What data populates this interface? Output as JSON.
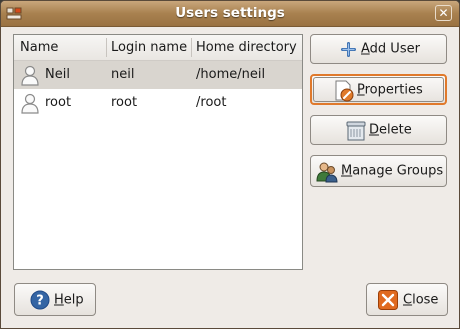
{
  "window": {
    "title": "Users settings",
    "close_glyph": "✕"
  },
  "table": {
    "columns": [
      "Name",
      "Login name",
      "Home directory"
    ],
    "rows": [
      {
        "name": "Neil",
        "login": "neil",
        "home": "/home/neil",
        "selected": true
      },
      {
        "name": "root",
        "login": "root",
        "home": "/root",
        "selected": false
      }
    ]
  },
  "buttons": {
    "add_user": {
      "mnemonic": "A",
      "rest": "dd User"
    },
    "properties": {
      "mnemonic": "P",
      "rest": "roperties"
    },
    "delete": {
      "mnemonic": "D",
      "rest": "elete"
    },
    "manage_groups": {
      "mnemonic": "M",
      "rest": "anage Groups"
    },
    "help": {
      "mnemonic": "H",
      "rest": "elp"
    },
    "close": {
      "mnemonic": "C",
      "rest": "lose"
    }
  },
  "icons": {
    "app": "users-app-icon",
    "user": "person-icon",
    "add": "plus-icon",
    "properties": "properties-icon",
    "delete": "delete-icon",
    "groups": "group-icon",
    "help": "help-icon",
    "close": "close-icon"
  },
  "colors": {
    "titlebar": "#a8814f",
    "focus_ring": "#e0792b",
    "selected_row": "#d9d5cf"
  }
}
